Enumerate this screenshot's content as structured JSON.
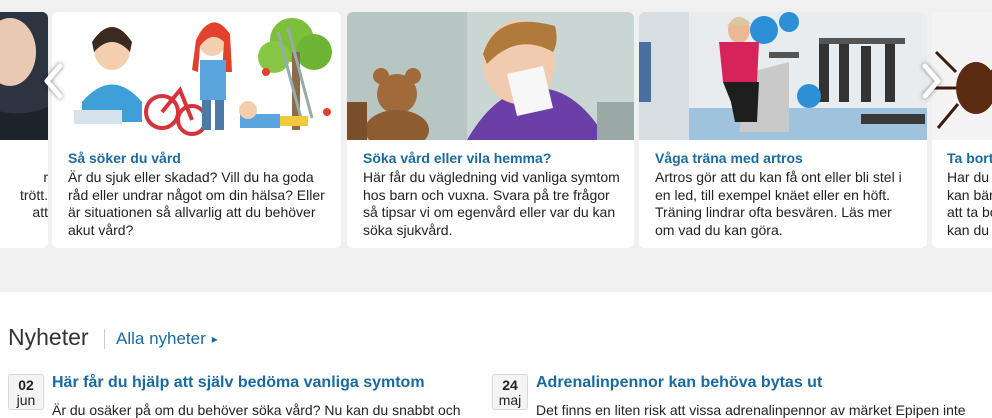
{
  "carousel": {
    "cards": [
      {
        "title": "",
        "text": "r\ntrött.\natt"
      },
      {
        "title": "Så söker du vård",
        "text": "Är du sjuk eller skadad? Vill du ha goda råd eller undrar något om din hälsa? Eller är situationen så allvarlig att du behöver akut vård?"
      },
      {
        "title": "Söka vård eller vila hemma?",
        "text": "Här får du vägledning vid vanliga symtom hos barn och vuxna. Svara på tre frågor så tipsar vi om egenvård eller var du kan söka sjukvård."
      },
      {
        "title": "Våga träna med artros",
        "text": "Artros gör att du kan få ont eller bli stel i en led, till exempel knäet eller en höft. Träning lindrar ofta besvären. Läs mer om vad du kan göra."
      },
      {
        "title": "Ta bort",
        "text": "Har du\nkan bär\natt ta bo\nkan du"
      }
    ],
    "prev_icon": "chevron-left-icon",
    "next_icon": "chevron-right-icon"
  },
  "news": {
    "heading": "Nyheter",
    "all_link": "Alla nyheter",
    "items": [
      {
        "day": "02",
        "month": "jun",
        "title": "Här får du hjälp att själv bedöma vanliga symtom",
        "text": "Är du osäker på om du behöver söka vård? Nu kan du snabbt och"
      },
      {
        "day": "24",
        "month": "maj",
        "title": "Adrenalinpennor kan behöva bytas ut",
        "text": "Det finns en liten risk att vissa adrenalinpennor av märket Epipen inte"
      }
    ]
  },
  "colors": {
    "link": "#1a6aa0",
    "background": "#f0f0f0"
  }
}
